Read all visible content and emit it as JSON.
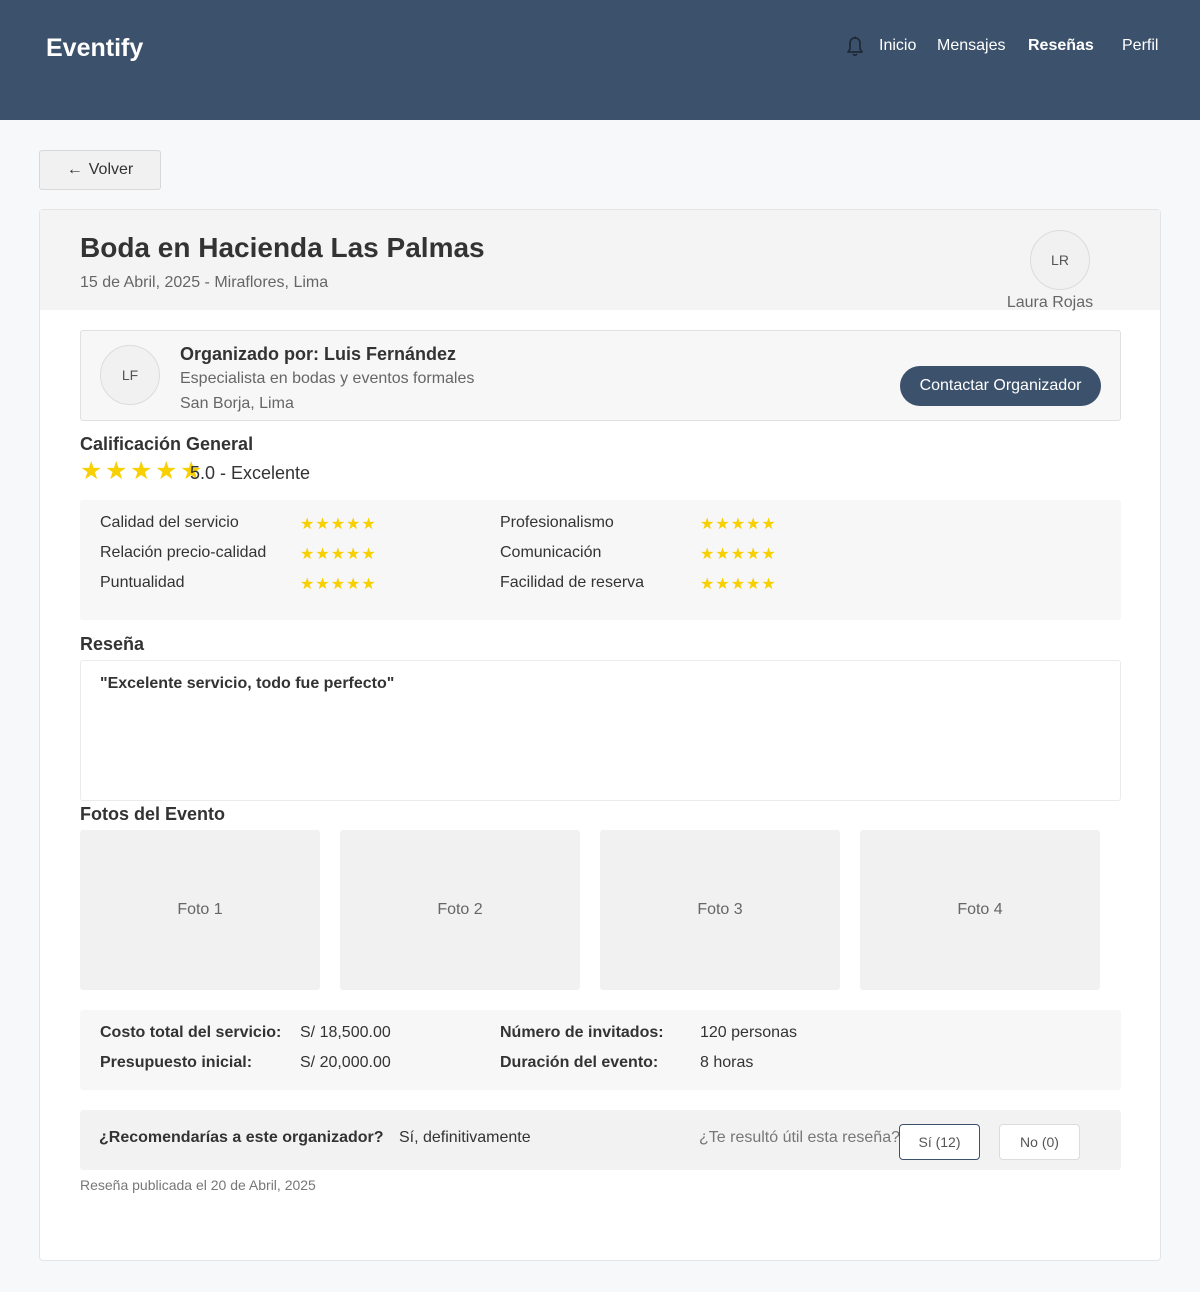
{
  "header": {
    "brand": "Eventify",
    "nav": [
      {
        "label": "Inicio",
        "active": false
      },
      {
        "label": "Mensajes",
        "active": false
      },
      {
        "label": "Reseñas",
        "active": true
      },
      {
        "label": "Perfil",
        "active": false
      }
    ],
    "bell_icon": "bell-icon",
    "colors": {
      "bar": "#3c516b",
      "background": "#f7f8fa",
      "star": "#f8d000"
    }
  },
  "back_button": {
    "arrow": "←",
    "label": "Volver"
  },
  "event": {
    "title": "Boda en Hacienda Las Palmas",
    "subtitle": "15 de Abril, 2025 - Miraflores, Lima",
    "reviewer_initials": "LR",
    "reviewer_name": "Laura Rojas"
  },
  "organizer": {
    "initials": "LF",
    "name": "Organizado por: Luis Fernández",
    "description": "Especialista en bodas y eventos formales",
    "location": "San Borja, Lima",
    "contact_label": "Contactar Organizador"
  },
  "rating": {
    "section_title": "Calificación General",
    "stars": 5,
    "score_text": "5.0 - Excelente",
    "criteria": [
      {
        "label": "Calidad del servicio",
        "stars": "★★★★★"
      },
      {
        "label": "Profesionalismo",
        "stars": "★★★★★"
      },
      {
        "label": "Relación precio-calidad",
        "stars": "★★★★★"
      },
      {
        "label": "Comunicación",
        "stars": "★★★★★"
      },
      {
        "label": "Puntualidad",
        "stars": "★★★★★"
      },
      {
        "label": "Facilidad de reserva",
        "stars": "★★★★★"
      }
    ]
  },
  "review": {
    "section_title": "Reseña",
    "text": "\"Excelente servicio, todo fue perfecto\""
  },
  "photos": {
    "section_title": "Fotos del Evento",
    "items": [
      "Foto 1",
      "Foto 2",
      "Foto 3",
      "Foto 4"
    ]
  },
  "costs": {
    "total_label": "Costo total del servicio:",
    "total_value": "S/ 18,500.00",
    "budget_label": "Presupuesto inicial:",
    "budget_value": "S/ 20,000.00",
    "guests_label": "Número de invitados:",
    "guests_value": "120 personas",
    "duration_label": "Duración del evento:",
    "duration_value": "8 horas"
  },
  "recommendation": {
    "question": "¿Recomendarías a este organizador?",
    "answer": "Sí, definitivamente",
    "useful_question": "¿Te resultó útil esta reseña?",
    "yes_label": "Sí (12)",
    "no_label": "No (0)"
  },
  "published": "Reseña publicada el 20 de Abril, 2025"
}
